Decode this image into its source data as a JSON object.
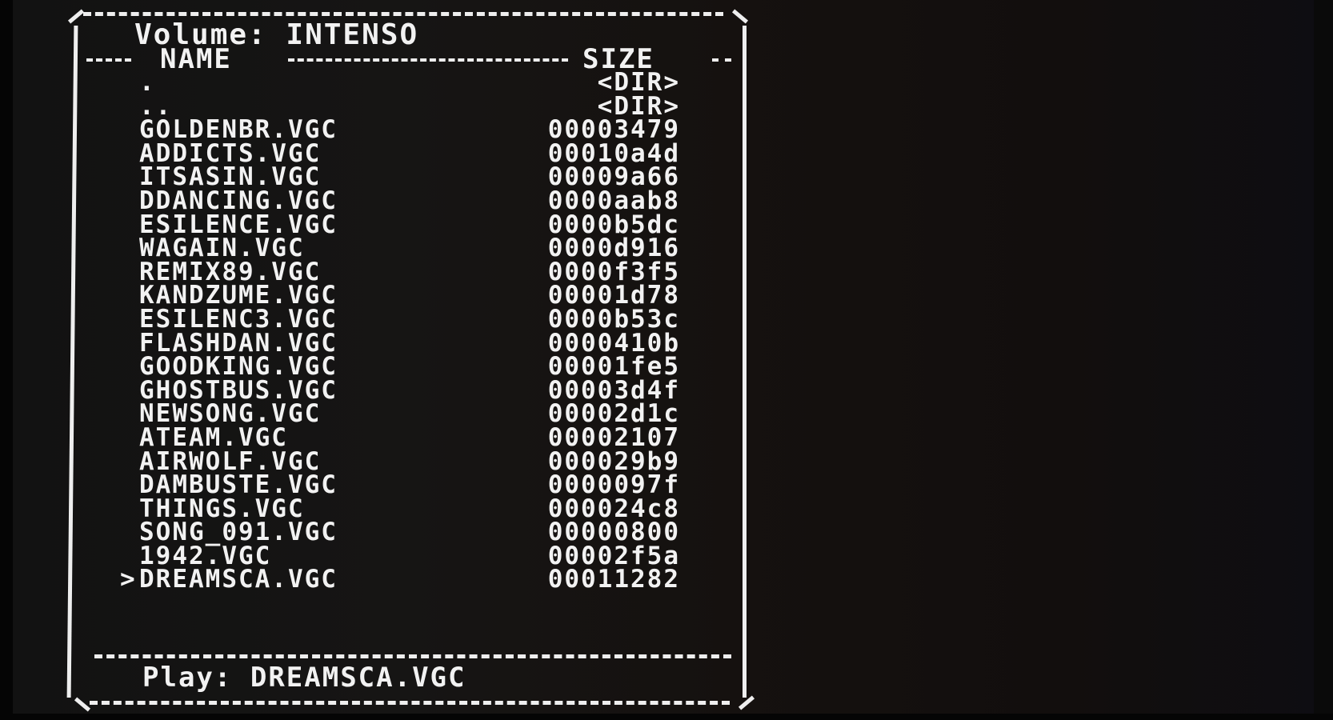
{
  "volume": {
    "label": "Volume:",
    "name": "INTENSO"
  },
  "columns": {
    "name": "NAME",
    "size": "SIZE"
  },
  "files": [
    {
      "name": ".",
      "size": "<DIR>",
      "selected": false
    },
    {
      "name": "..",
      "size": "<DIR>",
      "selected": false
    },
    {
      "name": "GOLDENBR.VGC",
      "size": "00003479",
      "selected": false
    },
    {
      "name": "ADDICTS.VGC",
      "size": "00010a4d",
      "selected": false
    },
    {
      "name": "ITSASIN.VGC",
      "size": "00009a66",
      "selected": false
    },
    {
      "name": "DDANCING.VGC",
      "size": "0000aab8",
      "selected": false
    },
    {
      "name": "ESILENCE.VGC",
      "size": "0000b5dc",
      "selected": false
    },
    {
      "name": "WAGAIN.VGC",
      "size": "0000d916",
      "selected": false
    },
    {
      "name": "REMIX89.VGC",
      "size": "0000f3f5",
      "selected": false
    },
    {
      "name": "KANDZUME.VGC",
      "size": "00001d78",
      "selected": false
    },
    {
      "name": "ESILENC3.VGC",
      "size": "0000b53c",
      "selected": false
    },
    {
      "name": "FLASHDAN.VGC",
      "size": "0000410b",
      "selected": false
    },
    {
      "name": "GOODKING.VGC",
      "size": "00001fe5",
      "selected": false
    },
    {
      "name": "GHOSTBUS.VGC",
      "size": "00003d4f",
      "selected": false
    },
    {
      "name": "NEWSONG.VGC",
      "size": "00002d1c",
      "selected": false
    },
    {
      "name": "ATEAM.VGC",
      "size": "00002107",
      "selected": false
    },
    {
      "name": "AIRWOLF.VGC",
      "size": "000029b9",
      "selected": false
    },
    {
      "name": "DAMBUSTE.VGC",
      "size": "0000097f",
      "selected": false
    },
    {
      "name": "THINGS.VGC",
      "size": "000024c8",
      "selected": false
    },
    {
      "name": "SONG_091.VGC",
      "size": "00000800",
      "selected": false
    },
    {
      "name": "1942.VGC",
      "size": "00002f5a",
      "selected": false
    },
    {
      "name": "DREAMSCA.VGC",
      "size": "00011282",
      "selected": true
    }
  ],
  "cursor": ">",
  "play": {
    "label": "Play:",
    "file": "DREAMSCA.VGC"
  },
  "colors": {
    "text": "#f2f2f2",
    "background": "#141211"
  }
}
